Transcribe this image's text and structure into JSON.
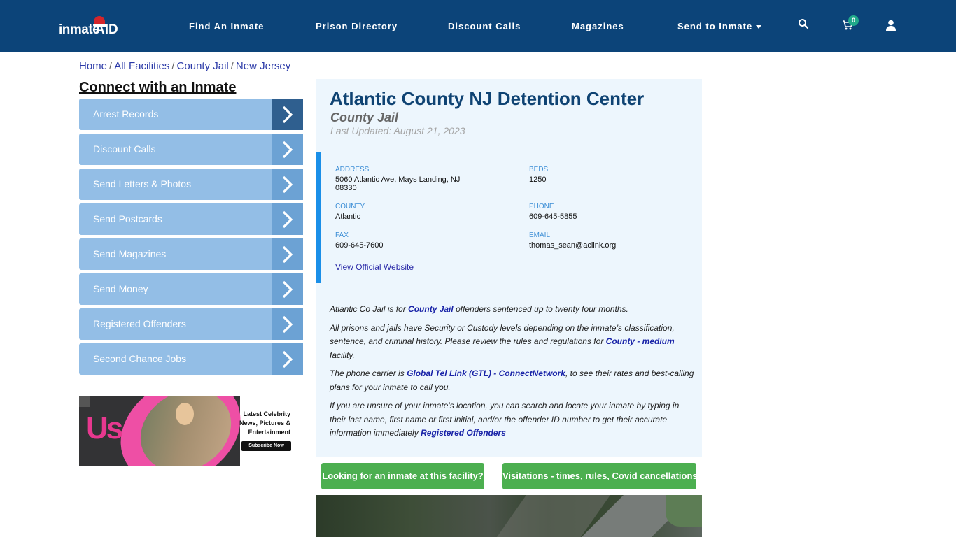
{
  "header": {
    "logo_text": "inmate",
    "logo_accent": "AID",
    "nav": [
      {
        "label": "Find An Inmate"
      },
      {
        "label": "Prison Directory"
      },
      {
        "label": "Discount Calls"
      },
      {
        "label": "Magazines"
      },
      {
        "label": "Send to Inmate",
        "dropdown": true
      }
    ],
    "icons": [
      "search-icon",
      "cart-icon",
      "user-icon"
    ],
    "cart_count": "0"
  },
  "breadcrumb": [
    {
      "label": "Home"
    },
    {
      "label": "All Facilities"
    },
    {
      "label": "County Jail"
    },
    {
      "label": "New Jersey"
    }
  ],
  "breadcrumb_sep": "/",
  "sidebar": {
    "title": "Connect with an Inmate",
    "items": [
      {
        "label": "Arrest Records"
      },
      {
        "label": "Discount Calls"
      },
      {
        "label": "Send Letters & Photos"
      },
      {
        "label": "Send Postcards"
      },
      {
        "label": "Send Magazines"
      },
      {
        "label": "Send Money"
      },
      {
        "label": "Registered Offenders"
      },
      {
        "label": "Second Chance Jobs"
      }
    ]
  },
  "ad": {
    "brand": "Us",
    "line1": "Latest Celebrity",
    "line2": "News, Pictures &",
    "line3": "Entertainment",
    "cta": "Subscribe Now"
  },
  "facility": {
    "name": "Atlantic County NJ Detention Center",
    "type": "County Jail",
    "last_updated": "Last Updated: August 21, 2023",
    "address_label": "ADDRESS",
    "address_line1": "5060 Atlantic Ave, Mays Landing, NJ",
    "address_line2": "08330",
    "beds_label": "BEDS",
    "beds": "1250",
    "county_label": "COUNTY",
    "county": "Atlantic",
    "phone_label": "PHONE",
    "phone": "609-645-5855",
    "fax_label": "FAX",
    "fax": "609-645-7600",
    "email_label": "EMAIL",
    "email": "thomas_sean@aclink.org",
    "website_link": "View Official Website"
  },
  "description": {
    "p1_a": "Atlantic Co Jail is for ",
    "p1_link": "County Jail",
    "p1_b": " offenders sentenced up to twenty four months.",
    "p2_a": "All prisons and jails have Security or Custody levels depending on the inmate’s classification, sentence, and criminal history. Please review the rules and regulations for ",
    "p2_link": "County - medium",
    "p2_b": " facility.",
    "p3_a": "The phone carrier is ",
    "p3_link": "Global Tel Link (GTL) - ConnectNetwork",
    "p3_b": ", to see their rates and best-calling plans for your inmate to call you.",
    "p4_a": "If you are unsure of your inmate's location, you can search and locate your inmate by typing in their last name, first name or first initial, and/or the offender ID number to get their accurate information immediately ",
    "p4_link": "Registered Offenders"
  },
  "buttons": {
    "find_inmate": "Looking for an inmate at this facility?",
    "visitations": "Visitations - times, rules, Covid cancellations"
  },
  "colors": {
    "header_bg": "#0c4479",
    "sidebar_item": "#93bee6",
    "sidebar_arrow": "#6ca2d4",
    "sidebar_arrow_active": "#2f5f8f",
    "panel_bg": "#edf6fd",
    "accent_bar": "#1a8fe8",
    "green_button": "#4caf50",
    "badge": "#20a98a"
  }
}
